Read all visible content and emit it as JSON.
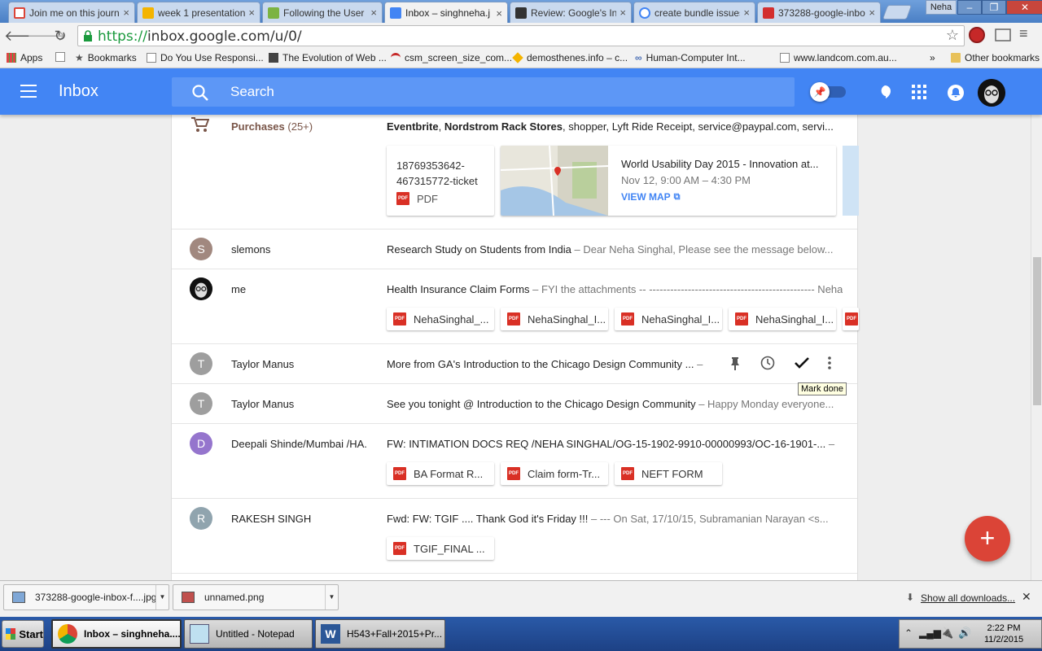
{
  "browser": {
    "tabs": [
      {
        "title": "Join me on this journ",
        "favicon_color": "#db4437"
      },
      {
        "title": "week 1 presentation",
        "favicon_color": "#f4b400"
      },
      {
        "title": "Following the User J",
        "favicon_color": "#7cb342"
      },
      {
        "title": "Inbox – singhneha.j",
        "favicon_color": "#4285f4"
      },
      {
        "title": "Review: Google's In",
        "favicon_color": "#333333"
      },
      {
        "title": "create bundle issues",
        "favicon_color": "#4285f4"
      },
      {
        "title": "373288-google-inbo",
        "favicon_color": "#d32f2f"
      }
    ],
    "user_chip": "Neha",
    "url_scheme": "https://",
    "url_rest": "inbox.google.com/u/0/",
    "bookmarks": [
      {
        "label": "Apps",
        "icon": "apps-grid-icon"
      },
      {
        "label": "Bookmarks",
        "icon": "star-icon"
      },
      {
        "label": "Do You Use Responsi...",
        "icon": "page-icon"
      },
      {
        "label": "The Evolution of Web ...",
        "icon": "book-icon"
      },
      {
        "label": "csm_screen_size_com...",
        "icon": "red-arc-icon"
      },
      {
        "label": "demosthenes.info – c...",
        "icon": "diamond-icon"
      },
      {
        "label": "Human-Computer Int...",
        "icon": "infinity-icon"
      },
      {
        "label": "www.landcom.com.au...",
        "icon": "page-icon"
      }
    ],
    "bookmarks_overflow": "»",
    "other_bookmarks": "Other bookmarks"
  },
  "inbox": {
    "title": "Inbox",
    "search_placeholder": "Search",
    "accent": "#4285f4"
  },
  "rows": {
    "purchases": {
      "label": "Purchases",
      "count": "(25+)",
      "subject_bold1": "Eventbrite",
      "subject_sep": ", ",
      "subject_bold2": "Nordstrom Rack Stores",
      "subject_rest": ", shopper, Lyft Ride Receipt, service@paypal.com, servi...",
      "ticket_line1": "18769353642-",
      "ticket_line2": "467315772-ticket",
      "ticket_type": "PDF",
      "event_title": "World Usability Day 2015 - Innovation at...",
      "event_time": "Nov 12, 9:00 AM – 4:30 PM",
      "event_link": "VIEW MAP"
    },
    "slemons": {
      "initial": "S",
      "sender": "slemons",
      "subject": "Research Study on Students from India",
      "snippet": " – Dear Neha Singhal, Please see the message below..."
    },
    "me": {
      "sender": "me",
      "subject": "Health Insurance Claim Forms",
      "snippet": " – FYI the attachments -- ----------------------------------------------- Neha...",
      "attachments": [
        "NehaSinghal_...",
        "NehaSinghal_I...",
        "NehaSinghal_I...",
        "NehaSinghal_I..."
      ]
    },
    "taylor1": {
      "initial": "T",
      "sender": "Taylor Manus",
      "subject": "More from GA's Introduction to the Chicago Design Community ...",
      "snippet": " –",
      "tooltip": "Mark done"
    },
    "taylor2": {
      "initial": "T",
      "sender": "Taylor Manus",
      "subject": "See you tonight @ Introduction to the Chicago Design Community",
      "snippet": " – Happy Monday everyone..."
    },
    "deepali": {
      "initial": "D",
      "sender": "Deepali Shinde/Mumbai /HA.",
      "subject": "FW: INTIMATION DOCS REQ /NEHA SINGHAL/OG-15-1902-9910-00000993/OC-16-1901-...",
      "snippet": " –",
      "attachments": [
        "BA Format R...",
        "Claim form-Tr...",
        "NEFT FORM"
      ]
    },
    "rakesh": {
      "initial": "R",
      "sender": "RAKESH SINGH",
      "subject": "Fwd: FW: TGIF .... Thank God it's Friday !!!",
      "snippet": " – --- On Sat, 17/10/15, Subramanian Narayan <s...",
      "attachments": [
        "TGIF_FINAL ..."
      ]
    }
  },
  "downloads": [
    {
      "name": "373288-google-inbox-f....jpg"
    },
    {
      "name": "unnamed.png"
    }
  ],
  "show_all_downloads": "Show all downloads...",
  "taskbar": {
    "start": "Start",
    "tasks": [
      {
        "label": "Inbox – singhneha...."
      },
      {
        "label": "Untitled - Notepad"
      },
      {
        "label": "H543+Fall+2015+Pr..."
      }
    ],
    "time": "2:22 PM",
    "date": "11/2/2015"
  },
  "fab_symbol": "+"
}
